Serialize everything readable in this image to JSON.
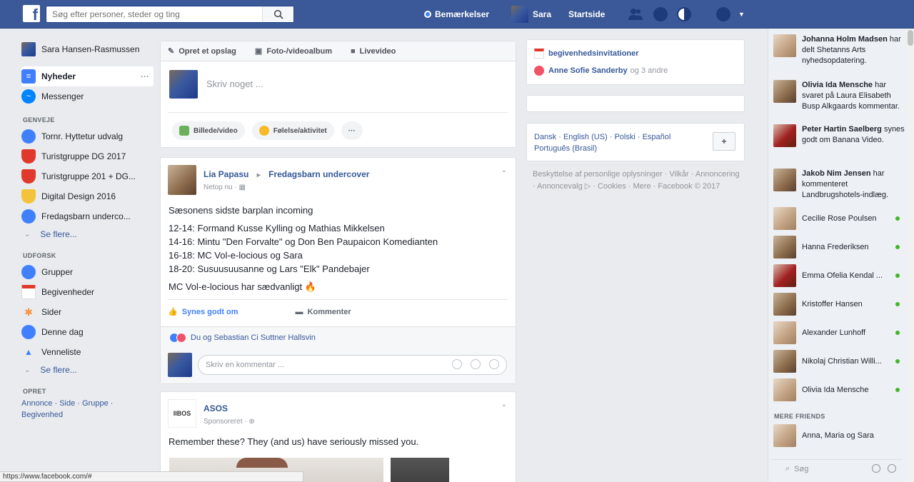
{
  "header": {
    "logo": "f",
    "search_placeholder": "Søg efter personer, steder og ting",
    "nav_notification_label": "Bemærkelser",
    "nav_user_name": "Sara",
    "nav_home": "Startside"
  },
  "left_nav": {
    "profile_name": "Sara Hansen-Rasmussen",
    "main_items": [
      {
        "label": "Nyheder",
        "icon": "news-feed-icon"
      },
      {
        "label": "Messenger",
        "icon": "messenger-icon"
      }
    ],
    "groups_heading": "GENVEJE",
    "group_items": [
      {
        "label": "Tornr. Hyttetur udvalg",
        "color": "#4080ff"
      },
      {
        "label": "Turistgruppe DG 2017",
        "color": "#e0392b"
      },
      {
        "label": "Turistgruppe 201 + DG...",
        "color": "#e0392b"
      },
      {
        "label": "Digital Design 2016",
        "color": "#f5c33b"
      },
      {
        "label": "Fredagsbarn underco...",
        "color": "#4080ff"
      }
    ],
    "see_more_1": "Se flere...",
    "explore_heading": "UDFORSK",
    "explore_items": [
      {
        "label": "Grupper",
        "color": "#4080ff"
      },
      {
        "label": "Begivenheder",
        "color": "#e0392b"
      },
      {
        "label": "Sider",
        "color": "#f7923a"
      },
      {
        "label": "Denne dag",
        "color": "#4080ff"
      },
      {
        "label": "Venneliste",
        "color": "#4080ff"
      }
    ],
    "see_more_2": "Se flere...",
    "create_heading": "OPRET",
    "create_links": "Annonce · Side · Gruppe · Begivenhed"
  },
  "composer": {
    "tab_post": "Opret et opslag",
    "tab_photo": "Foto-/videoalbum",
    "tab_live": "Livevideo",
    "placeholder": "Skriv noget ...",
    "btn_photo": "Billede/video",
    "btn_feeling": "Følelse/aktivitet",
    "btn_more": "···"
  },
  "post1": {
    "author": "Lia Papasu",
    "arrow": "▸",
    "group": "Fredagsbarn undercover",
    "meta": "Netop nu",
    "line0": "Sæsonens sidste barplan incoming",
    "lines": [
      "12-14: Formand Kusse Kylling og Mathias Mikkelsen",
      "14-16: Mintu \"Den Forvalte\" og Don Ben Paupaicon Komedianten",
      "16-18: MC Vol-e-locious og Sara",
      "18-20: Susuusuusanne og Lars \"Elk\" Pandebajer"
    ],
    "closing": "MC Vol-e-locious har sædvanligt 🔥",
    "like": "Synes godt om",
    "comment": "Kommenter",
    "likes_line": "Du og Sebastian Ci Suttner Hallsvin",
    "comment_placeholder": "Skriv en kommentar ..."
  },
  "post2": {
    "logo": "IIBOS",
    "author": "ASOS",
    "meta": "Sponsoreret",
    "text": "Remember these? They (and us) have seriously missed you."
  },
  "right_col": {
    "birthdays_link": "begivenhedsinvitationer",
    "event_person": "Anne Sofie Sanderby",
    "event_suffix": "og 3 andre",
    "languages": "Dansk · English (US) · Polski · Español",
    "languages_more": "Português (Brasil)",
    "footer": "Beskyttelse af personlige oplysninger · Vilkår · Annoncering · Annoncevalg ▷ · Cookies · Mere · Facebook © 2017"
  },
  "chat": {
    "activity": [
      {
        "name": "Johanna Holm Madsen",
        "text": "har delt Shetanns Arts nyhedsopdatering.",
        "tone": "pale"
      },
      {
        "name": "Olivia Ida Mensche",
        "text": "har svaret på Laura Elisabeth Busp Alkgaards kommentar.",
        "tone": "brown"
      },
      {
        "name": "Peter Hartin Saelberg",
        "text": "synes godt om Banana Video.",
        "tone": "red"
      },
      {
        "name": "Jakob Nim Jensen",
        "text": "har kommenteret Landbrugshotels-indlæg.",
        "tone": "brown"
      }
    ],
    "contacts": [
      {
        "name": "Cecilie Rose Poulsen",
        "tone": "pale"
      },
      {
        "name": "Hanna Frederiksen",
        "tone": "brown"
      },
      {
        "name": "Emma Ofelia Kendal ...",
        "tone": "red"
      },
      {
        "name": "Kristoffer Hansen",
        "tone": "brown"
      },
      {
        "name": "Alexander Lunhoff",
        "tone": "pale"
      },
      {
        "name": "Nikolaj Christian Willi...",
        "tone": "brown"
      },
      {
        "name": "Olivia Ida Mensche",
        "tone": "pale"
      }
    ],
    "more_friends_heading": "MERE FRIENDS",
    "more_friends": "Anna, Maria og Sara",
    "search_placeholder": "Søg"
  },
  "status_bar": "https://www.facebook.com/#"
}
